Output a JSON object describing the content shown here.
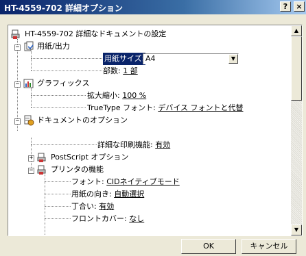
{
  "window": {
    "title": "HT-4559-702 詳細オプション",
    "help_label": "?",
    "close_label": "×"
  },
  "tree": {
    "root": "HT-4559-702 詳細なドキュメントの設定",
    "paper_output": {
      "label": "用紙/出力",
      "paper_size_label": "用紙サイズ:",
      "paper_size_value": "A4",
      "copies_label": "部数:",
      "copies_value": "1 部"
    },
    "graphics": {
      "label": "グラフィックス",
      "scaling_label": "拡大縮小:",
      "scaling_value": "100 %",
      "truetype_label": "TrueType フォント:",
      "truetype_value": "デバイス フォントと代替"
    },
    "doc_options": {
      "label": "ドキュメントのオプション",
      "advanced_label": "詳細な印刷機能:",
      "advanced_value": "有効",
      "postscript_label": "PostScript オプション",
      "printer_features": {
        "label": "プリンタの機能",
        "font_label": "フォント:",
        "font_value": "CIDネイティブモード",
        "orientation_label": "用紙の向き:",
        "orientation_value": "自動選択",
        "collate_label": "丁合い:",
        "collate_value": "有効",
        "frontcover_label": "フロントカバー:",
        "frontcover_value": "なし"
      }
    }
  },
  "buttons": {
    "ok": "OK",
    "cancel": "キャンセル"
  }
}
